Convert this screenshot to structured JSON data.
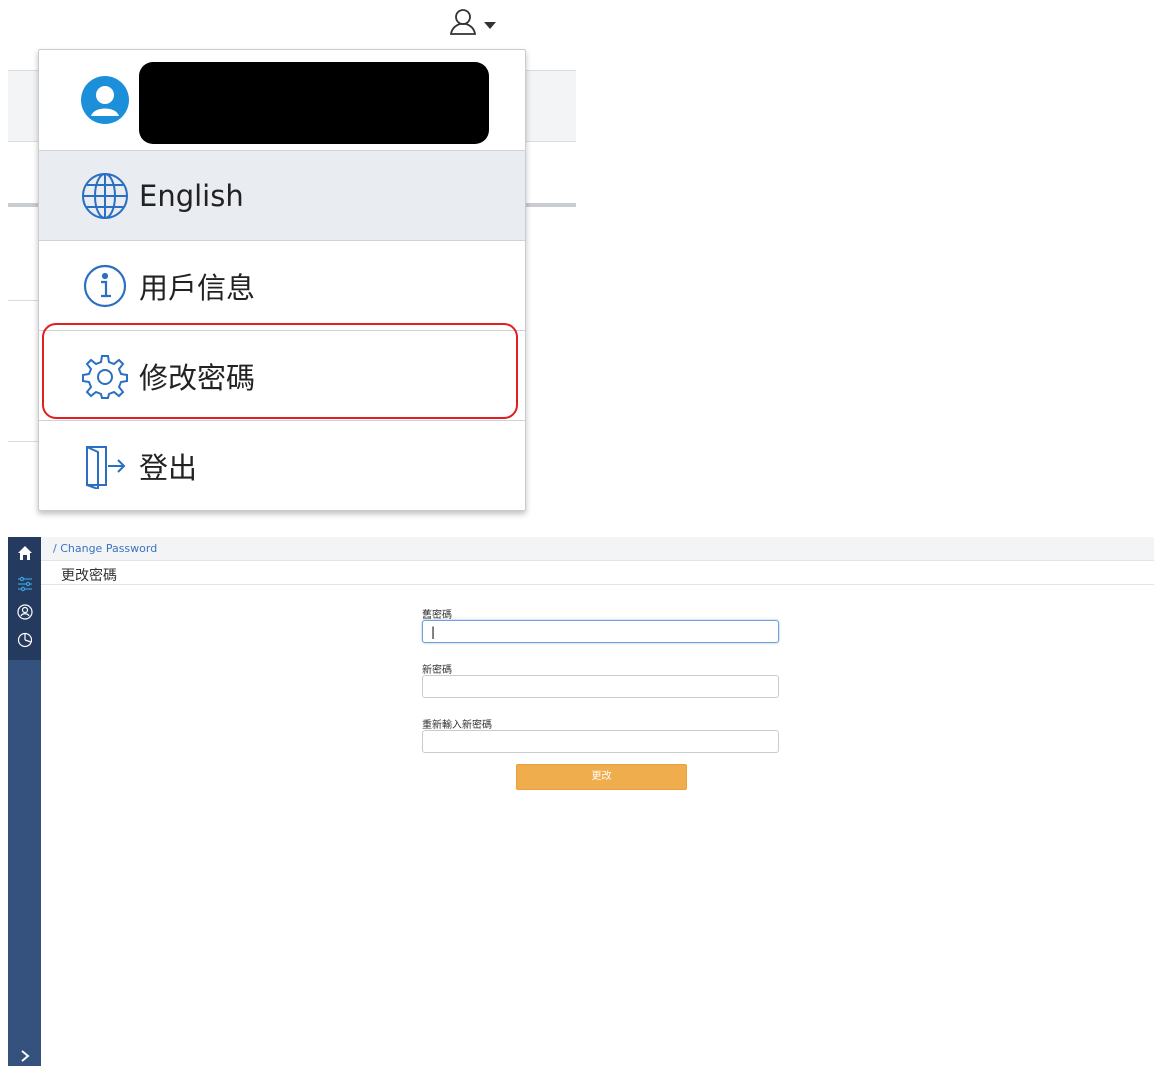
{
  "user_menu": {
    "trigger_icon": "user-icon",
    "caret_icon": "caret-down-icon",
    "items": [
      {
        "id": "language",
        "icon": "globe-icon",
        "label": "English"
      },
      {
        "id": "user-info",
        "icon": "info-icon",
        "label": "用戶信息"
      },
      {
        "id": "change-password",
        "icon": "gear-icon",
        "label": "修改密碼"
      },
      {
        "id": "logout",
        "icon": "door-exit-icon",
        "label": "登出"
      }
    ],
    "highlight_color": "#e02020"
  },
  "breadcrumb": {
    "text": "/ Change Password"
  },
  "page": {
    "title": "更改密碼",
    "fields": [
      {
        "label": "舊密碼",
        "value": "|",
        "placeholder": ""
      },
      {
        "label": "新密碼",
        "value": "",
        "placeholder": ""
      },
      {
        "label": "重新輸入新密碼",
        "value": "",
        "placeholder": ""
      }
    ],
    "submit_label": "更改",
    "submit_color": "#f0ad4e"
  },
  "sidebar": {
    "icons": [
      "home-icon",
      "sliders-icon",
      "person-circle-icon",
      "chart-pie-icon",
      "chevron-right-icon"
    ]
  }
}
